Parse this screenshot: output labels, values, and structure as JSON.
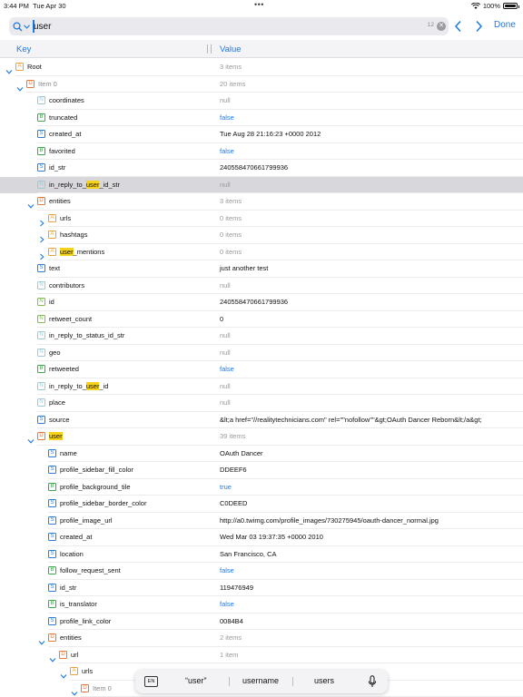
{
  "status": {
    "time": "3:44 PM",
    "date": "Tue Apr 30",
    "battery": "100%"
  },
  "search": {
    "value": "user",
    "count": "12",
    "done_label": "Done"
  },
  "header": {
    "key": "Key",
    "value": "Value"
  },
  "rows": [
    {
      "depth": 0,
      "chev": "down",
      "badge": "A",
      "key": "Root",
      "value": "3 items",
      "vclass": "count"
    },
    {
      "depth": 1,
      "chev": "down",
      "badge": "D",
      "key": "Item 0",
      "kdim": true,
      "value": "20 items",
      "vclass": "count"
    },
    {
      "depth": 2,
      "badge": "Z",
      "key": "coordinates",
      "value": "null",
      "vclass": "null"
    },
    {
      "depth": 2,
      "badge": "B",
      "key": "truncated",
      "value": "false",
      "vclass": "bool"
    },
    {
      "depth": 2,
      "badge": "S",
      "key": "created_at",
      "value": "Tue Aug 28 21:16:23 +0000 2012"
    },
    {
      "depth": 2,
      "badge": "B",
      "key": "favorited",
      "value": "false",
      "vclass": "bool"
    },
    {
      "depth": 2,
      "badge": "S",
      "key": "id_str",
      "value": "240558470661799936"
    },
    {
      "depth": 2,
      "badge": "Z",
      "key": "in_reply_to_user_id_str",
      "hl": "user",
      "value": "null",
      "vclass": "null",
      "selected": true
    },
    {
      "depth": 2,
      "chev": "down",
      "badge": "D",
      "key": "entities",
      "value": "3 items",
      "vclass": "count"
    },
    {
      "depth": 3,
      "chev": "right",
      "badge": "A",
      "key": "urls",
      "value": "0 items",
      "vclass": "count"
    },
    {
      "depth": 3,
      "chev": "right",
      "badge": "A",
      "key": "hashtags",
      "value": "0 items",
      "vclass": "count"
    },
    {
      "depth": 3,
      "chev": "right",
      "badge": "A",
      "key": "user_mentions",
      "hl": "user",
      "value": "0 items",
      "vclass": "count"
    },
    {
      "depth": 2,
      "badge": "S",
      "key": "text",
      "value": "just another test"
    },
    {
      "depth": 2,
      "badge": "Z",
      "key": "contributors",
      "value": "null",
      "vclass": "null"
    },
    {
      "depth": 2,
      "badge": "N",
      "key": "id",
      "value": "240558470661799936"
    },
    {
      "depth": 2,
      "badge": "N",
      "key": "retweet_count",
      "value": "0"
    },
    {
      "depth": 2,
      "badge": "Z",
      "key": "in_reply_to_status_id_str",
      "value": "null",
      "vclass": "null"
    },
    {
      "depth": 2,
      "badge": "Z",
      "key": "geo",
      "value": "null",
      "vclass": "null"
    },
    {
      "depth": 2,
      "badge": "B",
      "key": "retweeted",
      "value": "false",
      "vclass": "bool"
    },
    {
      "depth": 2,
      "badge": "Z",
      "key": "in_reply_to_user_id",
      "hl": "user",
      "value": "null",
      "vclass": "null"
    },
    {
      "depth": 2,
      "badge": "Z",
      "key": "place",
      "value": "null",
      "vclass": "null"
    },
    {
      "depth": 2,
      "badge": "S",
      "key": "source",
      "value": "&lt;a href=\"//realitytechnicians.com\" rel=\"\"nofollow\"\"&gt;OAuth Dancer Reborn&lt;/a&gt;"
    },
    {
      "depth": 2,
      "chev": "down",
      "badge": "D",
      "key": "user",
      "hl": "user",
      "value": "39 items",
      "vclass": "count"
    },
    {
      "depth": 3,
      "badge": "S",
      "key": "name",
      "value": "OAuth Dancer"
    },
    {
      "depth": 3,
      "badge": "S",
      "key": "profile_sidebar_fill_color",
      "value": "DDEEF6"
    },
    {
      "depth": 3,
      "badge": "B",
      "key": "profile_background_tile",
      "value": "true",
      "vclass": "bool"
    },
    {
      "depth": 3,
      "badge": "S",
      "key": "profile_sidebar_border_color",
      "value": "C0DEED"
    },
    {
      "depth": 3,
      "badge": "S",
      "key": "profile_image_url",
      "value": "http://a0.twimg.com/profile_images/730275945/oauth-dancer_normal.jpg"
    },
    {
      "depth": 3,
      "badge": "S",
      "key": "created_at",
      "value": "Wed Mar 03 19:37:35 +0000 2010"
    },
    {
      "depth": 3,
      "badge": "S",
      "key": "location",
      "value": "San Francisco, CA"
    },
    {
      "depth": 3,
      "badge": "B",
      "key": "follow_request_sent",
      "value": "false",
      "vclass": "bool"
    },
    {
      "depth": 3,
      "badge": "S",
      "key": "id_str",
      "value": "119476949"
    },
    {
      "depth": 3,
      "badge": "B",
      "key": "is_translator",
      "value": "false",
      "vclass": "bool"
    },
    {
      "depth": 3,
      "badge": "S",
      "key": "profile_link_color",
      "value": "0084B4"
    },
    {
      "depth": 3,
      "chev": "down",
      "badge": "D",
      "key": "entities",
      "value": "2 items",
      "vclass": "count"
    },
    {
      "depth": 4,
      "chev": "down",
      "badge": "D",
      "key": "url",
      "value": "1 item",
      "vclass": "count"
    },
    {
      "depth": 5,
      "chev": "down",
      "badge": "A",
      "key": "urls",
      "value": "",
      "vclass": "count"
    },
    {
      "depth": 6,
      "chev": "down",
      "badge": "D",
      "key": "Item 0",
      "kdim": true,
      "value": "",
      "vclass": "count"
    }
  ],
  "keyboard": {
    "lang": "EN",
    "suggestions": [
      "“user”",
      "username",
      "users"
    ]
  },
  "colors": {
    "accent": "#1a7ae6",
    "highlight": "#f7d21b",
    "selected_row": "#d8d8dc"
  }
}
